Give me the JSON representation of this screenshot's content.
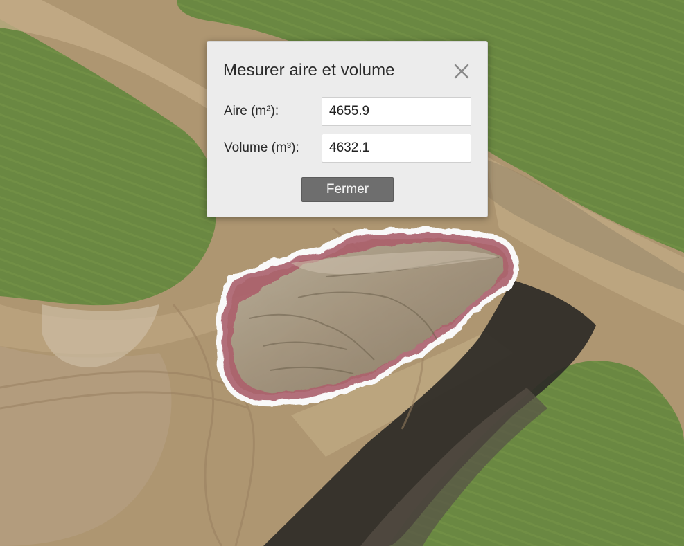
{
  "dialog": {
    "title": "Mesurer aire et volume",
    "fields": [
      {
        "label": "Aire (m²):",
        "value": "4655.9"
      },
      {
        "label": "Volume (m³):",
        "value": "4632.1"
      }
    ],
    "close_button_label": "Fermer",
    "close_icon": "close-icon"
  },
  "map": {
    "description_icon": "aerial-orthophoto",
    "colors": {
      "field_green": "#6b8a43",
      "dirt": "#b49b76",
      "stockpile": "#a79a86",
      "outline": "#ffffff",
      "fill_overlay": "#b06470",
      "shadow": "#2c2a26"
    }
  }
}
